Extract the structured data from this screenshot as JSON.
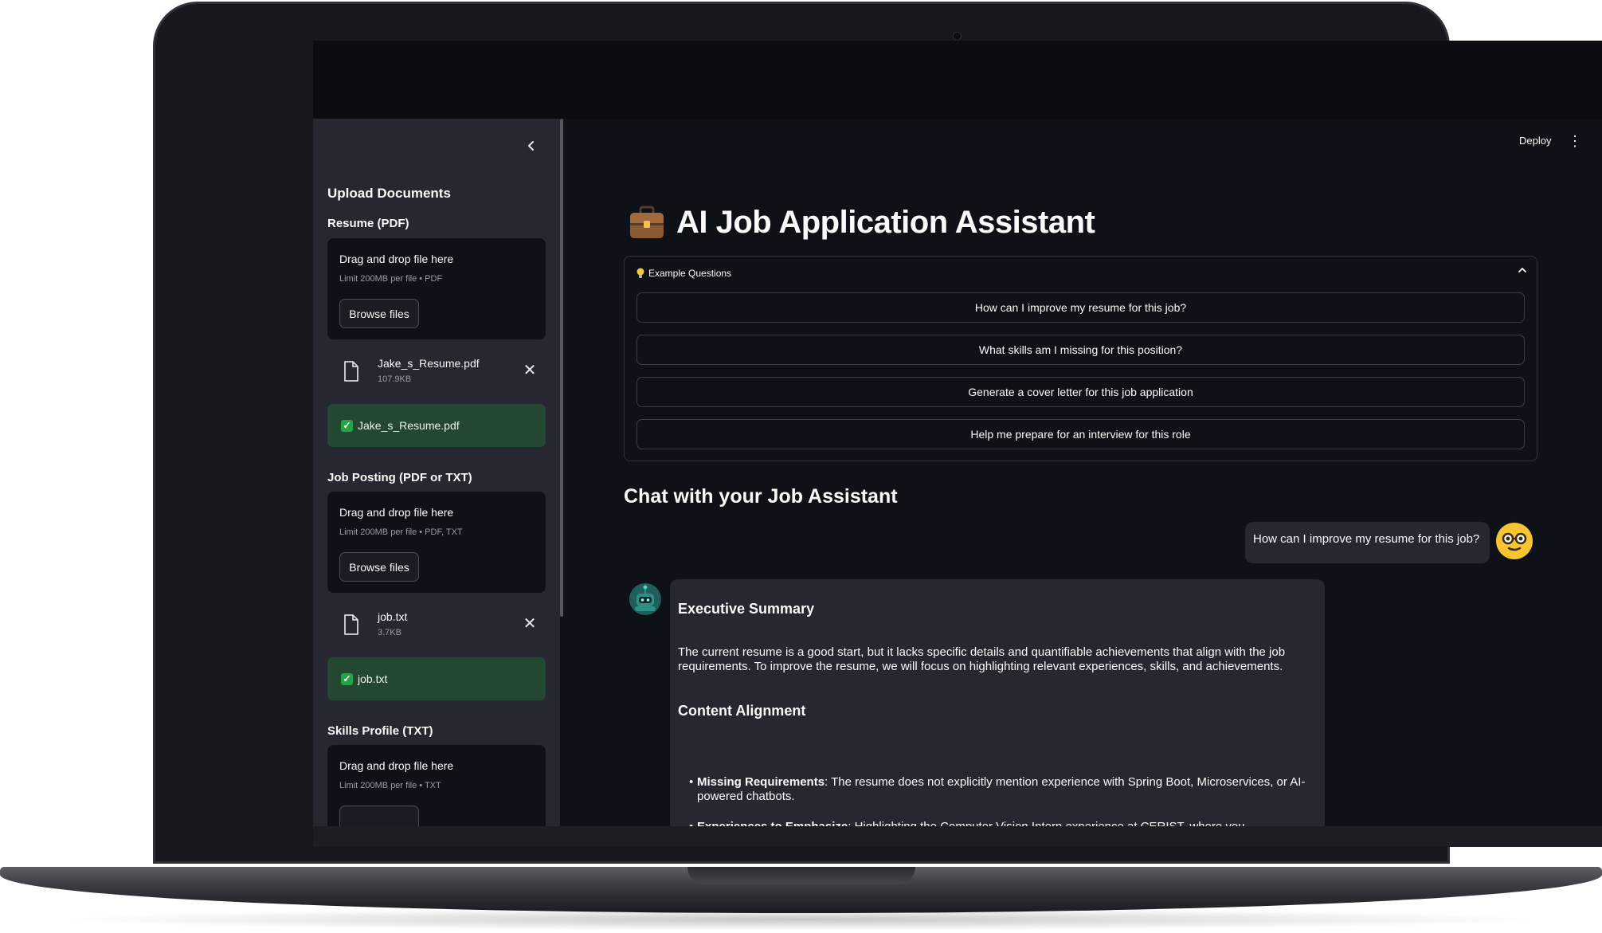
{
  "sidebar": {
    "heading": "Upload Documents",
    "resume": {
      "label": "Resume (PDF)",
      "dropzone_title": "Drag and drop file here",
      "dropzone_limit": "Limit 200MB per file • PDF",
      "browse_label": "Browse files",
      "file_name": "Jake_s_Resume.pdf",
      "file_size": "107.9KB",
      "success_text": "Jake_s_Resume.pdf"
    },
    "job_posting": {
      "label": "Job Posting (PDF or TXT)",
      "dropzone_title": "Drag and drop file here",
      "dropzone_limit": "Limit 200MB per file • PDF, TXT",
      "browse_label": "Browse files",
      "file_name": "job.txt",
      "file_size": "3.7KB",
      "success_text": "job.txt"
    },
    "skills": {
      "label": "Skills Profile (TXT)",
      "dropzone_title": "Drag and drop file here",
      "dropzone_limit": "Limit 200MB per file • TXT"
    }
  },
  "header": {
    "deploy_label": "Deploy"
  },
  "main": {
    "title": "AI Job Application Assistant",
    "examples": {
      "label": "Example Questions",
      "questions": [
        "How can I improve my resume for this job?",
        "What skills am I missing for this position?",
        "Generate a cover letter for this job application",
        "Help me prepare for an interview for this role"
      ]
    },
    "chat": {
      "heading": "Chat with your Job Assistant",
      "user_message": "How can I improve my resume for this job?",
      "assistant": {
        "h1": "Executive Summary",
        "p1": "The current resume is a good start, but it lacks specific details and quantifiable achievements that align with the job requirements. To improve the resume, we will focus on highlighting relevant experiences, skills, and achievements.",
        "h2": "Content Alignment",
        "bullet1_bold": "Missing Requirements",
        "bullet1_text": ": The resume does not explicitly mention experience with Spring Boot, Microservices, or AI-powered chatbots.",
        "bullet2_bold": "Experiences to Emphasize",
        "bullet2_text": ": Highlighting the Computer Vision Intern experience at CERIST, where you"
      }
    }
  },
  "colors": {
    "app_bg": "#0e1117",
    "sidebar_bg": "#262730",
    "success_bg": "#244731",
    "text": "#fafafa"
  },
  "icons": [
    "chevron-left-icon",
    "file-icon",
    "close-icon",
    "check-icon",
    "briefcase-icon",
    "bulb-icon",
    "chevron-up-icon",
    "more-vert-icon",
    "user-avatar-icon",
    "bot-avatar-icon"
  ]
}
